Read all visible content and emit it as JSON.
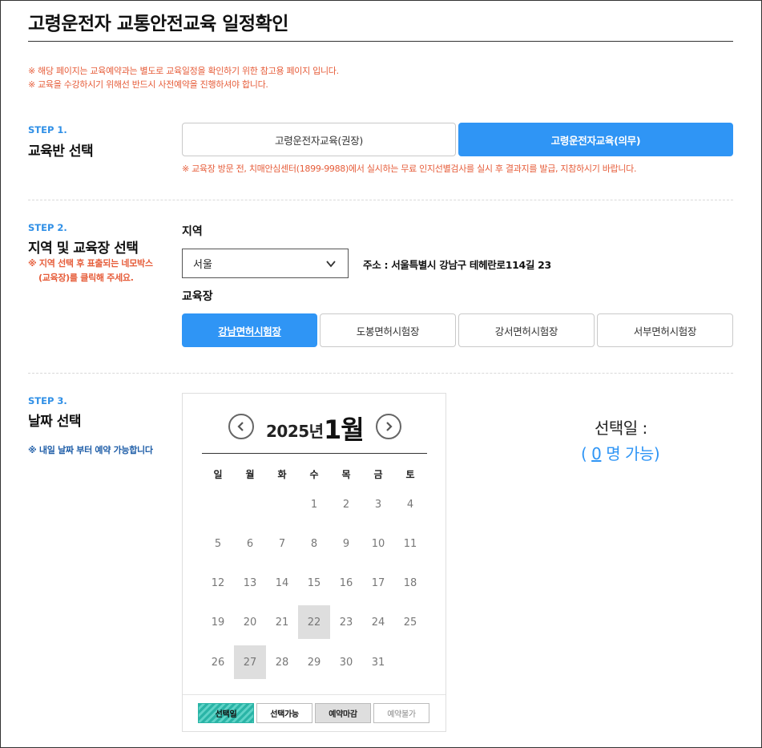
{
  "page": {
    "title": "고령운전자 교통안전교육 일정확인",
    "notices": [
      "※ 해당 페이지는 교육예약과는 별도로 교육일정을 확인하기 위한 참고용 페이지 입니다.",
      "※ 교육을 수강하시기 위해선 반드시 사전예약을 진행하셔야 합니다."
    ]
  },
  "step1": {
    "label": "STEP 1.",
    "title": "교육반 선택",
    "options": [
      {
        "label": "고령운전자교육(권장)",
        "selected": false
      },
      {
        "label": "고령운전자교육(의무)",
        "selected": true
      }
    ],
    "note": "※ 교육장 방문 전, 치매안심센터(1899-9988)에서 실시하는 무료 인지선별검사를 실시 후 결과지를 발급, 지참하시기 바랍니다."
  },
  "step2": {
    "label": "STEP 2.",
    "title": "지역 및 교육장 선택",
    "note_line1": "※ 지역 선택 후 표출되는 네모박스",
    "note_line2": "(교육장)를 클릭해 주세요.",
    "region_label": "지역",
    "region_value": "서울",
    "address": "주소 : 서울특별시 강남구 테헤란로114길 23",
    "center_label": "교육장",
    "centers": [
      {
        "label": "강남면허시험장",
        "selected": true
      },
      {
        "label": "도봉면허시험장",
        "selected": false
      },
      {
        "label": "강서면허시험장",
        "selected": false
      },
      {
        "label": "서부면허시험장",
        "selected": false
      }
    ]
  },
  "step3": {
    "label": "STEP 3.",
    "title": "날짜 선택",
    "note": "※ 내일 날짜 부터 예약 가능합니다"
  },
  "calendar": {
    "year_text": "2025년",
    "month_text": "1월",
    "weekdays": [
      "일",
      "월",
      "화",
      "수",
      "목",
      "금",
      "토"
    ],
    "days": [
      "1",
      "2",
      "3",
      "4",
      "5",
      "6",
      "7",
      "8",
      "9",
      "10",
      "11",
      "12",
      "13",
      "14",
      "15",
      "16",
      "17",
      "18",
      "19",
      "20",
      "21",
      "22",
      "23",
      "24",
      "25",
      "26",
      "27",
      "28",
      "29",
      "30",
      "31"
    ],
    "first_weekday": 3,
    "closed_days": [
      22,
      27
    ],
    "legend": {
      "selected": "선택일",
      "available": "선택가능",
      "closed": "예약마감",
      "unavailable": "예약불가"
    }
  },
  "selection": {
    "label": "선택일 :",
    "count_open": "(",
    "count_value": "0",
    "count_text": "명 가능)"
  },
  "colors": {
    "accent": "#2f95f5",
    "notice": "#e65c39",
    "step_label": "#2f8fe6",
    "closed_day": "#dedede",
    "legend_selected": "#2ab4a6"
  }
}
